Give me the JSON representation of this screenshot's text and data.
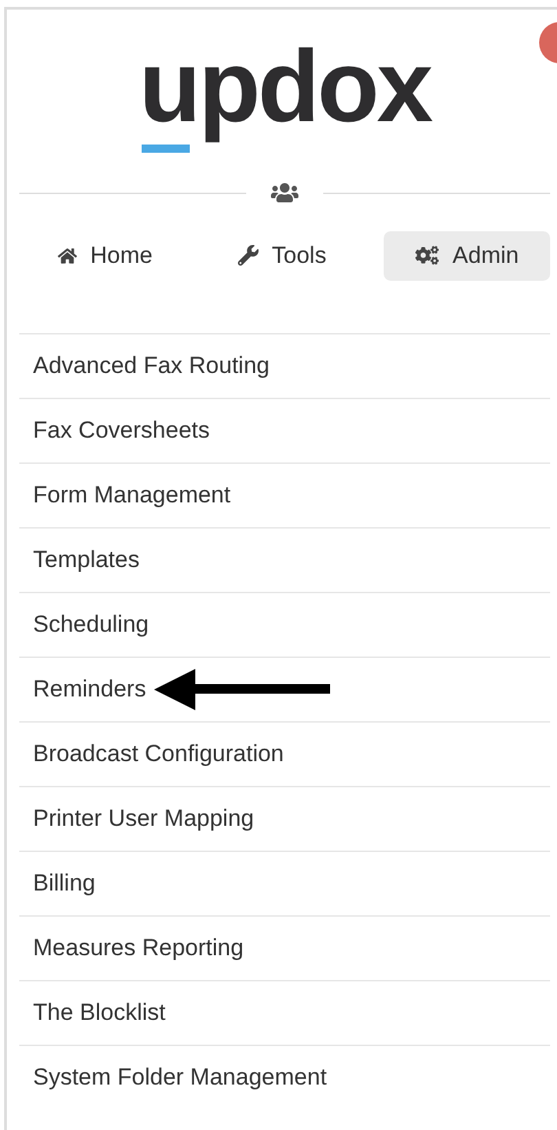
{
  "logo": "updox",
  "nav_tabs": [
    {
      "label": "Home",
      "kind": "home",
      "selected": false
    },
    {
      "label": "Tools",
      "kind": "wrench",
      "selected": false
    },
    {
      "label": "Admin",
      "kind": "gears",
      "selected": true
    }
  ],
  "menu_items": [
    {
      "label": "Advanced Fax Routing",
      "arrow": false
    },
    {
      "label": "Fax Coversheets",
      "arrow": false
    },
    {
      "label": "Form Management",
      "arrow": false
    },
    {
      "label": "Templates",
      "arrow": false
    },
    {
      "label": "Scheduling",
      "arrow": false
    },
    {
      "label": "Reminders",
      "arrow": true
    },
    {
      "label": "Broadcast Configuration",
      "arrow": false
    },
    {
      "label": "Printer User Mapping",
      "arrow": false
    },
    {
      "label": "Billing",
      "arrow": false
    },
    {
      "label": "Measures Reporting",
      "arrow": false
    },
    {
      "label": "The Blocklist",
      "arrow": false
    },
    {
      "label": "System Folder Management",
      "arrow": false
    }
  ]
}
